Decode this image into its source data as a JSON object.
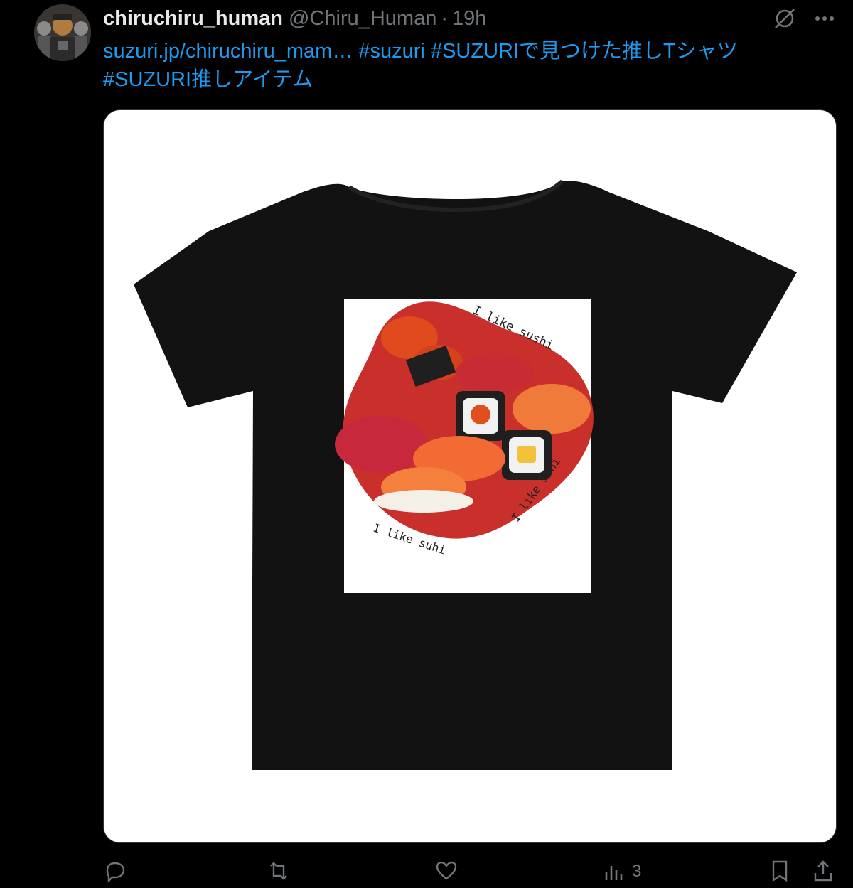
{
  "tweet": {
    "display_name": "chiruchiru_human",
    "handle": "@Chiru_Human",
    "separator": "·",
    "time": "19h",
    "text": {
      "link": "suzuri.jp/chiruchiru_mam…",
      "tag1": "#suzuri",
      "tag2": "#SUZURIで見つけた推しTシャツ",
      "tag3": "#SUZURI推しアイテム"
    }
  },
  "media": {
    "print_text_1": "I like sushi",
    "print_text_2": "I like suhi",
    "print_text_3": "I like suhi"
  },
  "actions": {
    "views_count": "3"
  },
  "icons": [
    "avatar",
    "grok-icon",
    "more-icon",
    "reply-icon",
    "retweet-icon",
    "like-icon",
    "views-icon",
    "bookmark-icon",
    "share-icon"
  ],
  "colors": {
    "background": "#000000",
    "link": "#1d9bf0",
    "muted": "#71767b",
    "text": "#e7e9ea"
  }
}
